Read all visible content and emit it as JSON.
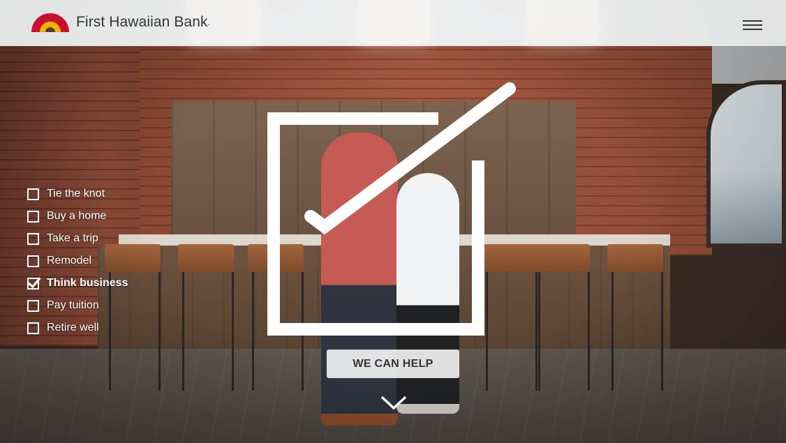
{
  "brand": {
    "name": "First Hawaiian Bank",
    "colors": {
      "logo_red": "#c8102e",
      "logo_yellow": "#f2b200"
    }
  },
  "header": {
    "menu_icon": "hamburger-menu-icon"
  },
  "goals": [
    {
      "label": "Tie the knot",
      "checked": false
    },
    {
      "label": "Buy a home",
      "checked": false
    },
    {
      "label": "Take a trip",
      "checked": false
    },
    {
      "label": "Remodel",
      "checked": false
    },
    {
      "label": "Think business",
      "checked": true
    },
    {
      "label": "Pay tuition",
      "checked": false
    },
    {
      "label": "Retire well",
      "checked": false
    }
  ],
  "hero": {
    "graphic_icon": "large-checkbox-check-icon",
    "cta_label": "WE CAN HELP",
    "scroll_icon": "chevron-down-icon"
  }
}
